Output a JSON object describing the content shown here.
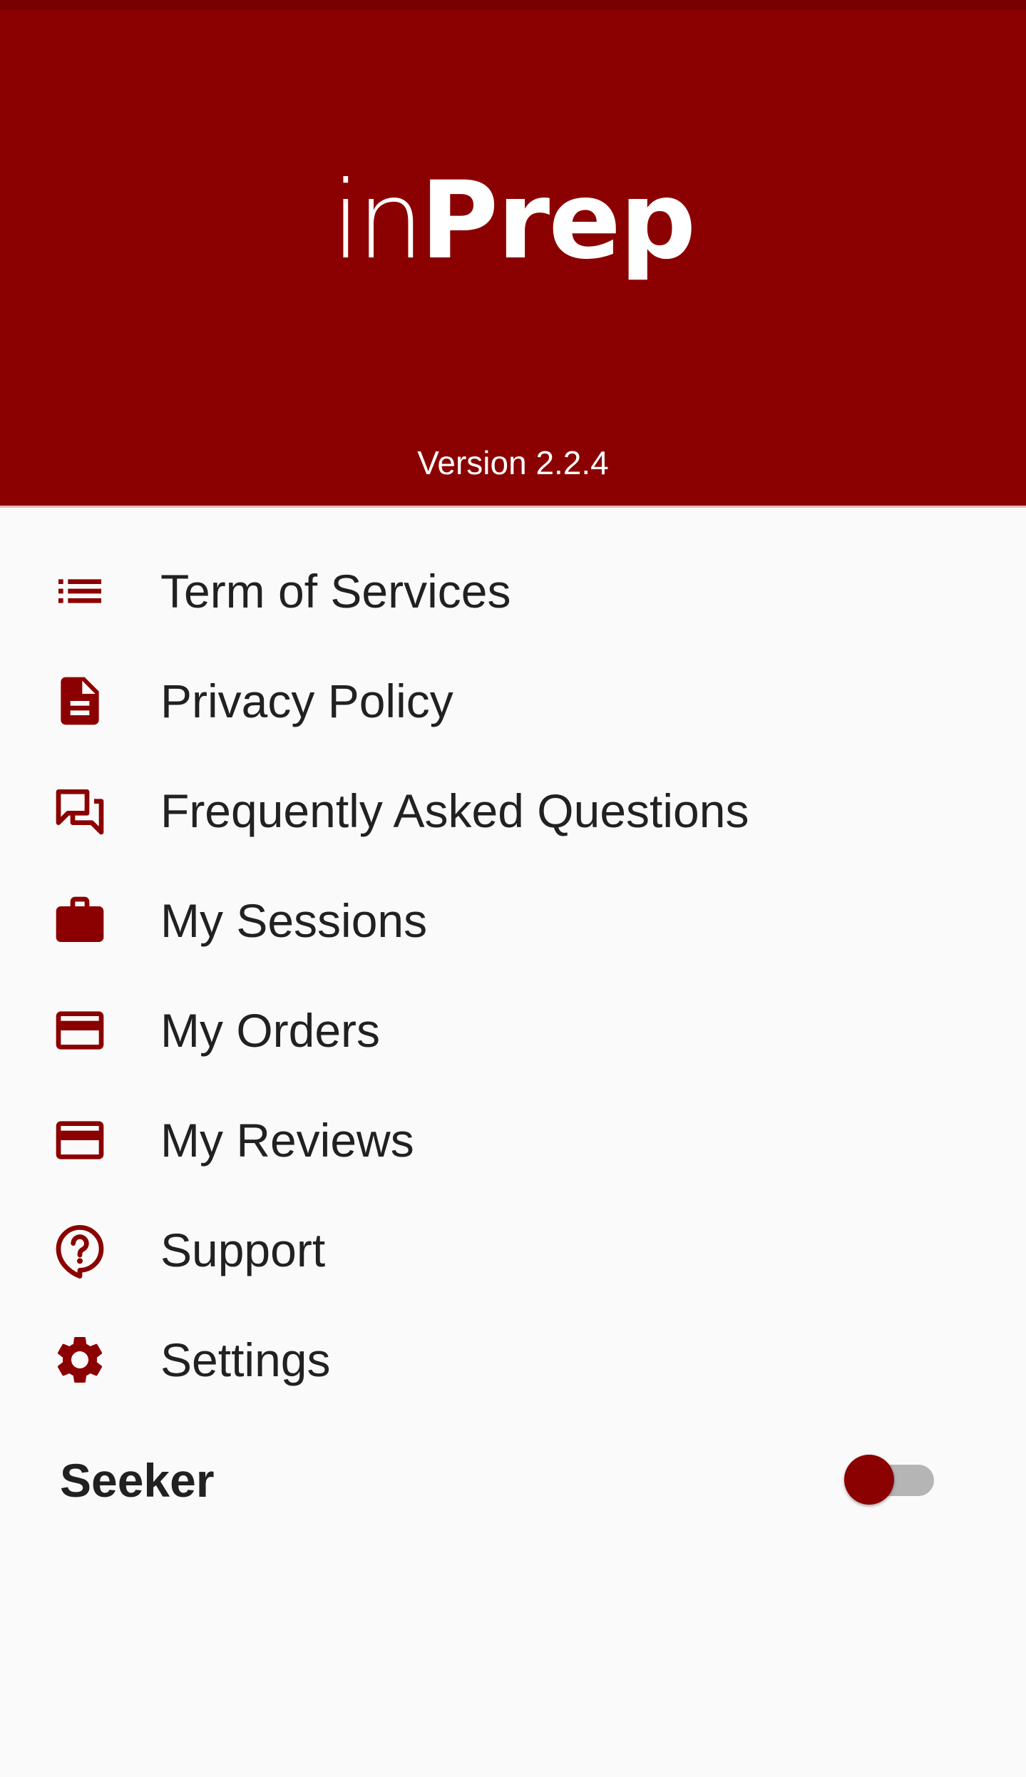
{
  "header": {
    "logo_in": "in",
    "logo_prep": "Prep",
    "version": "Version 2.2.4"
  },
  "menu": {
    "items": [
      {
        "label": "Term of Services",
        "icon": "list-icon"
      },
      {
        "label": "Privacy Policy",
        "icon": "document-icon"
      },
      {
        "label": "Frequently Asked Questions",
        "icon": "forum-icon"
      },
      {
        "label": "My Sessions",
        "icon": "briefcase-icon"
      },
      {
        "label": "My Orders",
        "icon": "credit-card-icon"
      },
      {
        "label": "My Reviews",
        "icon": "credit-card-icon"
      },
      {
        "label": "Support",
        "icon": "help-bubble-icon"
      },
      {
        "label": "Settings",
        "icon": "gear-icon"
      }
    ]
  },
  "seeker": {
    "label": "Seeker",
    "toggle_on": false
  },
  "colors": {
    "brand": "#8B0000",
    "text": "#212121",
    "background": "#FAFAFA"
  }
}
